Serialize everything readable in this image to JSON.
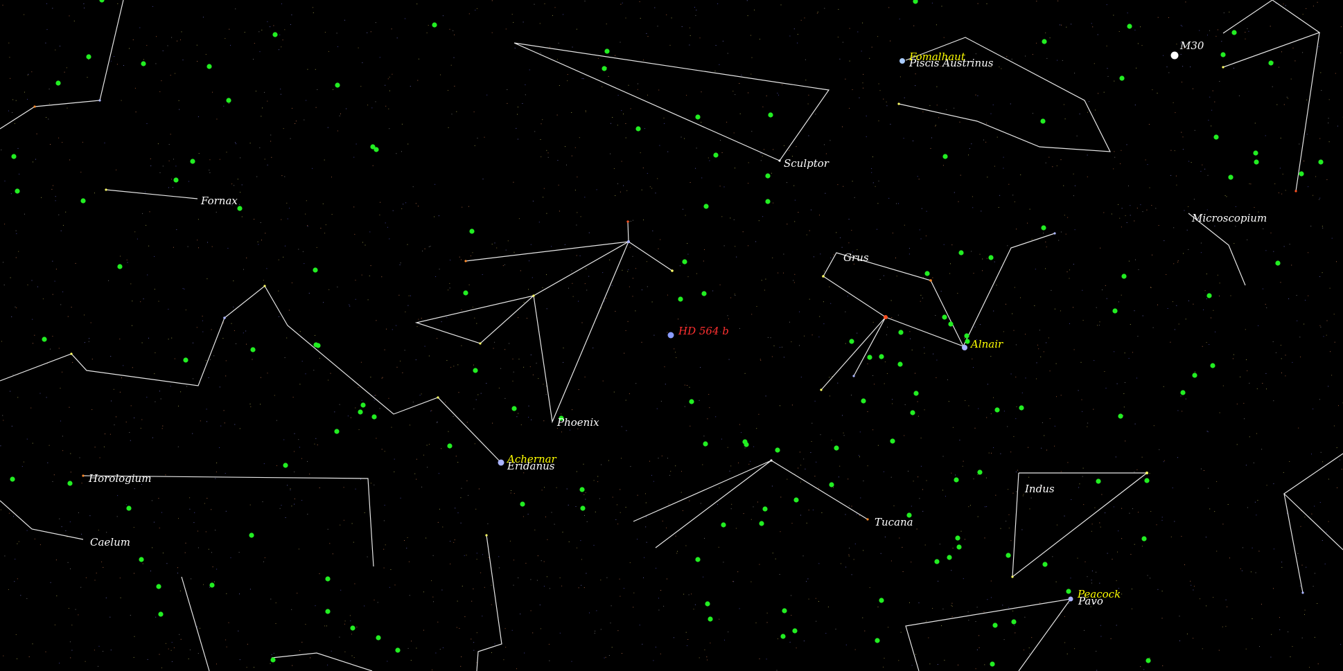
{
  "constellation_labels": [
    {
      "id": "fornax",
      "text": "Fornax"
    },
    {
      "id": "sculptor",
      "text": "Sculptor"
    },
    {
      "id": "piscis-austrinus",
      "text": "Piscis Austrinus"
    },
    {
      "id": "microscopium",
      "text": "Microscopium"
    },
    {
      "id": "grus",
      "text": "Grus"
    },
    {
      "id": "phoenix",
      "text": "Phoenix"
    },
    {
      "id": "eridanus",
      "text": "Eridanus"
    },
    {
      "id": "horologium",
      "text": "Horologium"
    },
    {
      "id": "caelum",
      "text": "Caelum"
    },
    {
      "id": "tucana",
      "text": "Tucana"
    },
    {
      "id": "indus",
      "text": "Indus"
    },
    {
      "id": "pavo",
      "text": "Pavo"
    }
  ],
  "star_labels": [
    {
      "id": "fomalhaut",
      "text": "Fomalhaut"
    },
    {
      "id": "achernar",
      "text": "Achernar"
    },
    {
      "id": "alnair",
      "text": "Alnair"
    },
    {
      "id": "peacock",
      "text": "Peacock"
    }
  ],
  "object_labels": [
    {
      "id": "m30",
      "text": "M30"
    }
  ],
  "target": {
    "text": "HD 564 b"
  },
  "colors": {
    "background": "#000000",
    "constellation_line": "#e8e8e8",
    "constellation_label": "#ffffff",
    "star_label": "#ffff00",
    "target_label": "#ff3030",
    "marker": "#22ee22",
    "star_blue": "#aab4ff"
  }
}
